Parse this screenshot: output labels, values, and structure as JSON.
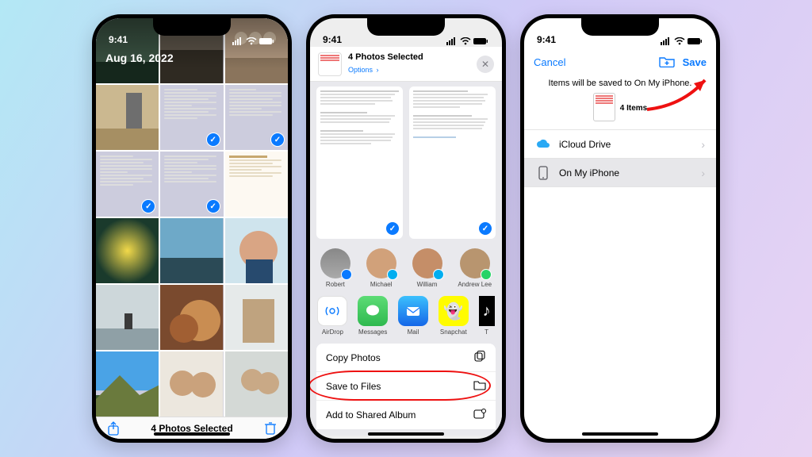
{
  "status": {
    "time": "9:41"
  },
  "phone1": {
    "date": "Aug 16, 2022",
    "toolbar": {
      "selected_label": "4 Photos Selected"
    }
  },
  "phone2": {
    "header": {
      "title": "4 Photos Selected",
      "options": "Options",
      "chev": "›"
    },
    "contacts": [
      {
        "name": "Robert",
        "badge_color": "#0a7aff"
      },
      {
        "name": "Michael",
        "badge_color": "#00aef0"
      },
      {
        "name": "William",
        "badge_color": "#00aef0"
      },
      {
        "name": "Andrew Lee",
        "badge_color": "#25d366"
      }
    ],
    "apps": [
      {
        "name": "AirDrop",
        "bg": "#fff",
        "glyph": "◎",
        "fg": "#0a7aff"
      },
      {
        "name": "Messages",
        "bg": "#34c759",
        "glyph": "✉︎"
      },
      {
        "name": "Mail",
        "bg": "#1e7cff",
        "glyph": "✉︎"
      },
      {
        "name": "Snapchat",
        "bg": "#fffc00",
        "glyph": "👻",
        "fg": "#000"
      },
      {
        "name": "T",
        "bg": "#000",
        "glyph": "♪"
      }
    ],
    "actions": {
      "copy": "Copy Photos",
      "save": "Save to Files",
      "add": "Add to Shared Album"
    }
  },
  "phone3": {
    "nav": {
      "cancel": "Cancel",
      "save": "Save"
    },
    "message": "Items will be saved to On My iPhone.",
    "items_label": "4 Items",
    "locations": [
      {
        "name": "iCloud Drive",
        "selected": false
      },
      {
        "name": "On My iPhone",
        "selected": true
      }
    ]
  }
}
